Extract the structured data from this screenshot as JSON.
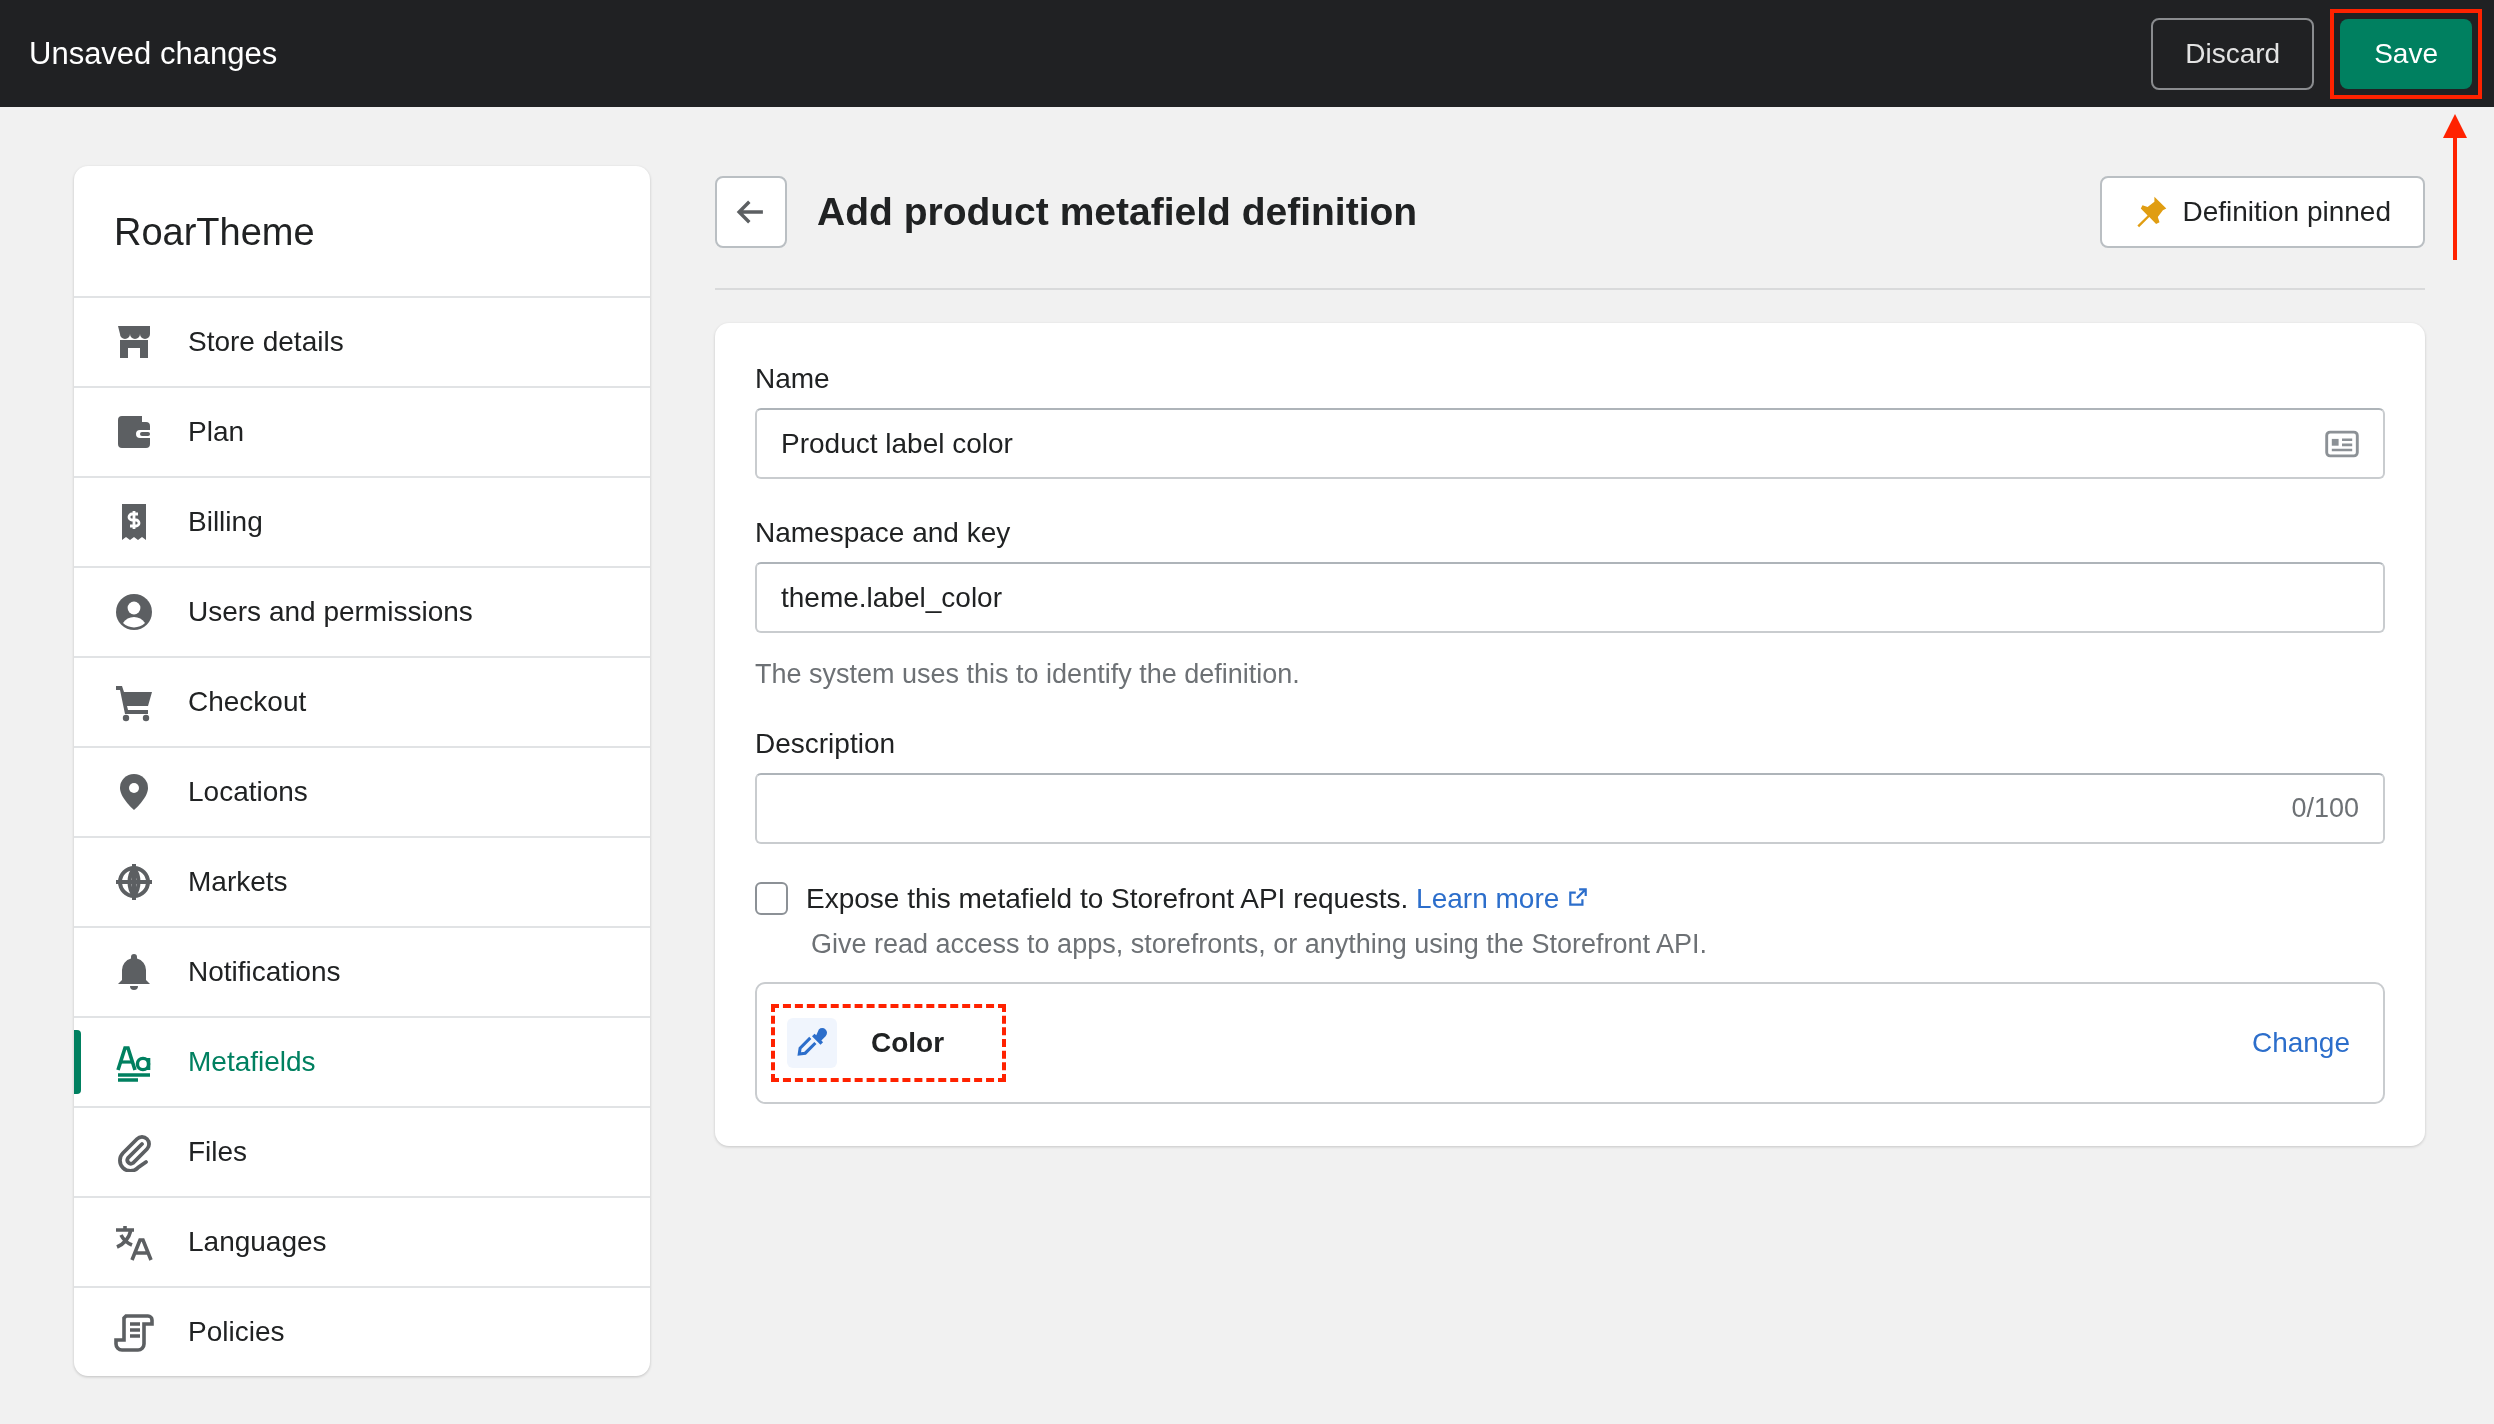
{
  "top_bar": {
    "title": "Unsaved changes",
    "discard": {
      "label": "Discard"
    },
    "save": {
      "label": "Save",
      "highlighted": true
    },
    "callout_arrow": true
  },
  "sidebar": {
    "title": "RoarTheme",
    "items": [
      {
        "label": "Store details",
        "selected": false
      },
      {
        "label": "Plan",
        "selected": false
      },
      {
        "label": "Billing",
        "selected": false
      },
      {
        "label": "Users and permissions",
        "selected": false
      },
      {
        "label": "Checkout",
        "selected": false
      },
      {
        "label": "Locations",
        "selected": false
      },
      {
        "label": "Markets",
        "selected": false
      },
      {
        "label": "Notifications",
        "selected": false
      },
      {
        "label": "Metafields",
        "selected": true
      },
      {
        "label": "Files",
        "selected": false
      },
      {
        "label": "Languages",
        "selected": false
      },
      {
        "label": "Policies",
        "selected": false
      }
    ]
  },
  "header": {
    "title": "Add product metafield definition",
    "pin_button": {
      "label": "Definition pinned"
    }
  },
  "form": {
    "name": {
      "label": "Name",
      "value": "Product label color"
    },
    "namespace": {
      "label": "Namespace and key",
      "value": "theme.label_color",
      "help": "The system uses this to identify the definition."
    },
    "description": {
      "label": "Description",
      "counter": "0/100"
    },
    "storefront": {
      "label": "Expose this metafield to Storefront API requests.",
      "link": "Learn more",
      "checked": false,
      "help": "Give read access to apps, storefronts, or anything using the Storefront API."
    },
    "type": {
      "label": "Color",
      "highlighted": true,
      "change": "Change"
    }
  }
}
